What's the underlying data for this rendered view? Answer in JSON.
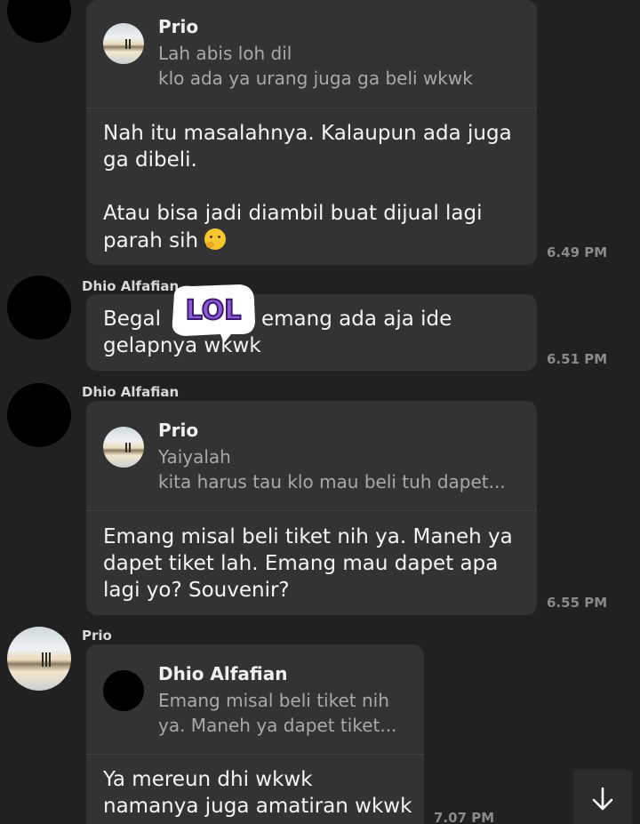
{
  "messages": [
    {
      "reply": {
        "name": "Prio",
        "lines": [
          "Lah abis loh dil",
          "klo ada ya urang juga ga beli wkwk"
        ]
      },
      "lines": [
        "Nah itu masalahnya. Kalaupun ada juga",
        "ga dibeli.",
        "",
        "Atau bisa jadi diambil buat dijual lagi",
        "parah sih"
      ],
      "time": "6.49 PM"
    },
    {
      "sender": "Dhio Alfafian",
      "lines": [
        "Begal",
        "emang ada aja ide",
        "gelapnya wkwk"
      ],
      "sticker_text": "LOL",
      "time": "6.51 PM"
    },
    {
      "sender": "Dhio Alfafian",
      "reply": {
        "name": "Prio",
        "lines": [
          "Yaiyalah",
          "kita harus tau klo mau beli tuh dapet..."
        ]
      },
      "lines": [
        "Emang misal beli tiket nih ya. Maneh ya",
        "dapet tiket lah. Emang mau dapet apa",
        "lagi yo? Souvenir?"
      ],
      "time": "6.55 PM"
    },
    {
      "sender": "Prio",
      "reply": {
        "name": "Dhio Alfafian",
        "lines": [
          "Emang misal beli tiket nih",
          "ya. Maneh ya dapet tiket..."
        ]
      },
      "lines": [
        "Ya mereun dhi wkwk",
        "namanya juga amatiran wkwk"
      ],
      "time": "7.07 PM"
    }
  ],
  "icons": {
    "thinking_emoji": "thinking-face-emoji",
    "scroll_down": "arrow-down-icon"
  },
  "colors": {
    "background": "#212121",
    "bubble": "#333333",
    "sticker_fill": "#8e5ad8"
  }
}
